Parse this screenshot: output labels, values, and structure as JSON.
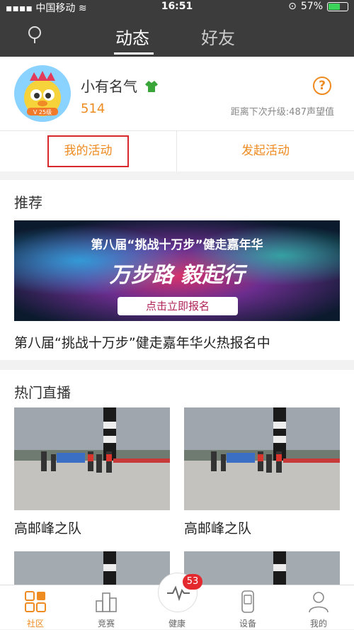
{
  "status": {
    "carrier": "中国移动",
    "time": "16:51",
    "battery": "57%"
  },
  "nav": {
    "tabs": [
      "动态",
      "好友"
    ],
    "active_tab": "动态"
  },
  "profile": {
    "name": "小有名气",
    "score": "514",
    "upgrade_text": "距离下次升级:487声望值",
    "help": "?",
    "my_activity": "我的活动",
    "start_activity": "发起活动"
  },
  "recommend": {
    "title": "推荐",
    "banner_headline": "第八届“挑战十万步”健走嘉年华",
    "banner_big": "万步路 毅起行",
    "banner_button": "点击立即报名",
    "caption": "第八届“挑战十万步”健走嘉年华火热报名中"
  },
  "live": {
    "title": "热门直播",
    "items": [
      {
        "name": "高邮峰之队"
      },
      {
        "name": "高邮峰之队"
      }
    ]
  },
  "tabbar": {
    "items": [
      "社区",
      "竞赛",
      "健康",
      "设备",
      "我的"
    ],
    "badge": "53"
  },
  "colors": {
    "accent": "#ee8b21",
    "header": "#3c3c3c",
    "badge": "#e3292d"
  }
}
